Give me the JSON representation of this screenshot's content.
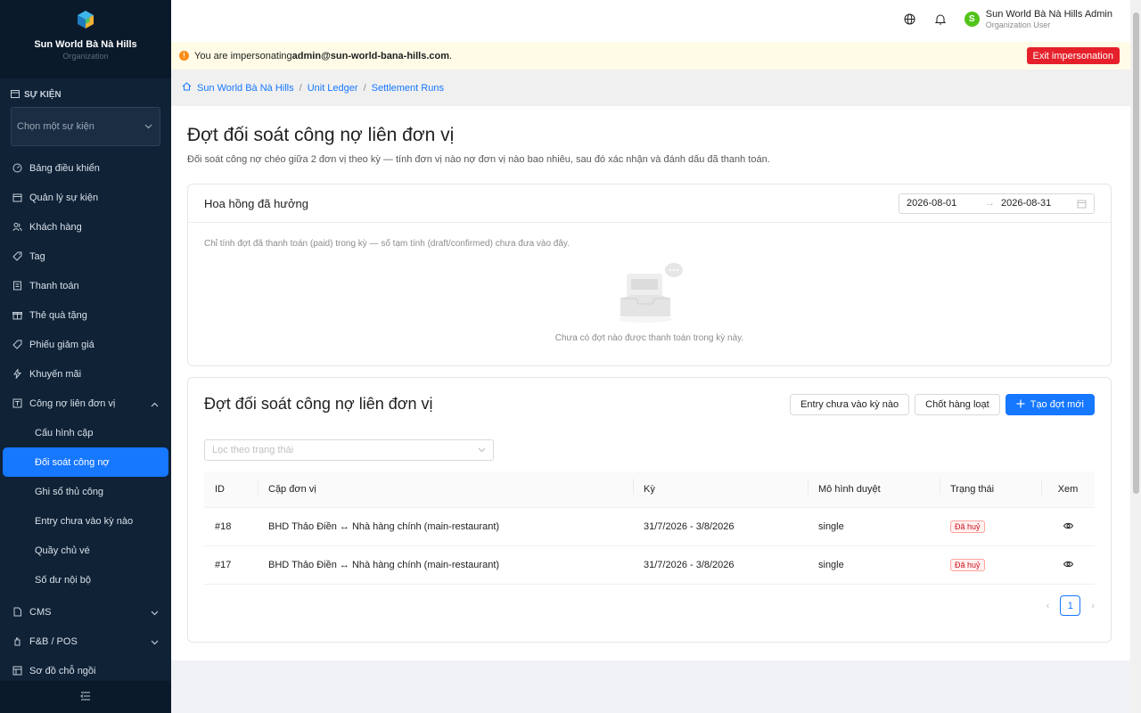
{
  "sidebar": {
    "brand_name": "Sun World Bà Nà Hills",
    "brand_sub": "Organization",
    "section_title": "SỰ KIỆN",
    "event_select_placeholder": "Chọn một sự kiện",
    "items": [
      {
        "label": "Bảng điều khiển"
      },
      {
        "label": "Quản lý sự kiện"
      },
      {
        "label": "Khách hàng"
      },
      {
        "label": "Tag"
      },
      {
        "label": "Thanh toán"
      },
      {
        "label": "Thẻ quà tặng"
      },
      {
        "label": "Phiếu giảm giá"
      },
      {
        "label": "Khuyến mãi"
      },
      {
        "label": "Công nợ liên đơn vị"
      }
    ],
    "sub_items": [
      {
        "label": "Cấu hình cặp"
      },
      {
        "label": "Đối soát công nợ"
      },
      {
        "label": "Ghi sổ thủ công"
      },
      {
        "label": "Entry chưa vào kỳ nào"
      },
      {
        "label": "Quầy chủ vé"
      },
      {
        "label": "Số dư nội bộ"
      }
    ],
    "bottom_items": [
      {
        "label": "CMS"
      },
      {
        "label": "F&B / POS"
      },
      {
        "label": "Sơ đồ chỗ ngồi"
      }
    ]
  },
  "header": {
    "user_initial": "S",
    "user_name": "Sun World Bà Nà Hills Admin",
    "user_role": "Organization User"
  },
  "banner": {
    "prefix": "You are impersonating ",
    "email": "admin@sun-world-bana-hills.com",
    "suffix": ".",
    "exit_label": "Exit impersonation"
  },
  "breadcrumb": {
    "items": [
      "Sun World Bà Nà Hills",
      "Unit Ledger",
      "Settlement Runs"
    ]
  },
  "page": {
    "title": "Đợt đối soát công nợ liên đơn vị",
    "description": "Đối soát công nợ chéo giữa 2 đơn vị theo kỳ — tính đơn vị nào nợ đơn vị nào bao nhiêu, sau đó xác nhận và đánh dấu đã thanh toán."
  },
  "commission_card": {
    "title": "Hoa hồng đã hưởng",
    "date_from": "2026-08-01",
    "date_to": "2026-08-31",
    "note": "Chỉ tính đợt đã thanh toán (paid) trong kỳ — số tạm tính (draft/confirmed) chưa đưa vào đây.",
    "empty_text": "Chưa có đợt nào được thanh toán trong kỳ này."
  },
  "runs_card": {
    "title": "Đợt đối soát công nợ liên đơn vị",
    "btn_unassigned": "Entry chưa vào kỳ nào",
    "btn_bulk_close": "Chốt hàng loạt",
    "btn_create": "Tạo đợt mới",
    "filter_placeholder": "Lọc theo trạng thái",
    "columns": {
      "id": "ID",
      "pair": "Cặp đơn vị",
      "period": "Kỳ",
      "model": "Mô hình duyệt",
      "status": "Trạng thái",
      "view": "Xem"
    },
    "rows": [
      {
        "id": "#18",
        "pair": "BHD Thảo Điền ↔ Nhà hàng chính (main-restaurant)",
        "period": "31/7/2026 - 3/8/2026",
        "model": "single",
        "status": "Đã huỷ"
      },
      {
        "id": "#17",
        "pair": "BHD Thảo Điền ↔ Nhà hàng chính (main-restaurant)",
        "period": "31/7/2026 - 3/8/2026",
        "model": "single",
        "status": "Đã huỷ"
      }
    ],
    "current_page": "1"
  },
  "colors": {
    "primary": "#1677ff",
    "sidebar_bg": "#0f2236",
    "danger": "#e5202a",
    "banner_bg": "#fffbe6"
  }
}
